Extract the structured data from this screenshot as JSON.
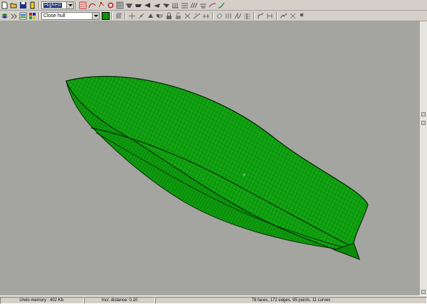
{
  "toolbar1": {
    "quality_value": "Highest",
    "colors": {
      "hull_green": "#119011",
      "selection_blue": "#0a246a"
    }
  },
  "toolbar2": {
    "selection_value": "Close hull"
  },
  "viewport": {
    "background": "#a4a4a1",
    "model": "hull-wireframe-icon"
  },
  "status": {
    "undo_memory": "Undo memory : 402 Kb.",
    "incr_distance": "Incr. distance: 0.10",
    "model_stats": "78 faces, 172 edges, 95 points, 11 curves"
  }
}
